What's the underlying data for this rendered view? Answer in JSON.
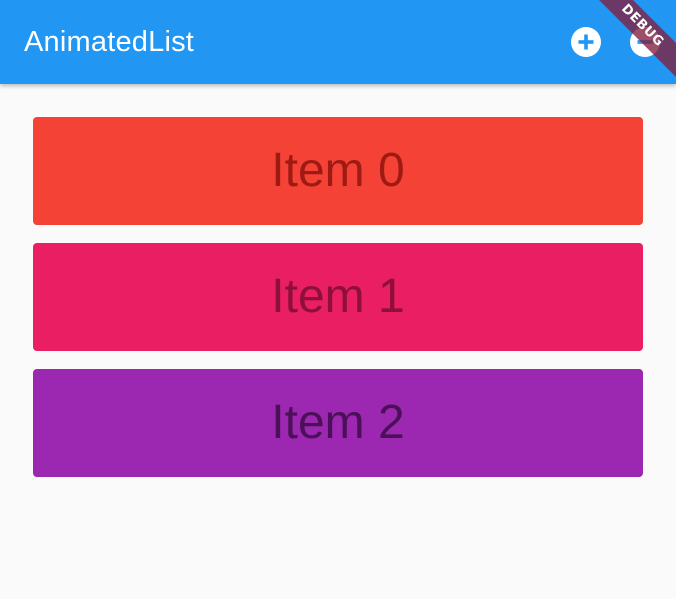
{
  "appbar": {
    "title": "AnimatedList",
    "actions": [
      {
        "name": "add-button",
        "icon": "add-circle-icon"
      },
      {
        "name": "remove-button",
        "icon": "remove-circle-icon"
      }
    ],
    "background": "#2196f3"
  },
  "debug_banner": {
    "label": "DEBUG"
  },
  "list": {
    "items": [
      {
        "label": "Item 0",
        "color": "#f44336",
        "text_color": "#9e1a12"
      },
      {
        "label": "Item 1",
        "color": "#e91e63",
        "text_color": "#8c1038"
      },
      {
        "label": "Item 2",
        "color": "#9c27b0",
        "text_color": "#4a1058"
      }
    ]
  }
}
